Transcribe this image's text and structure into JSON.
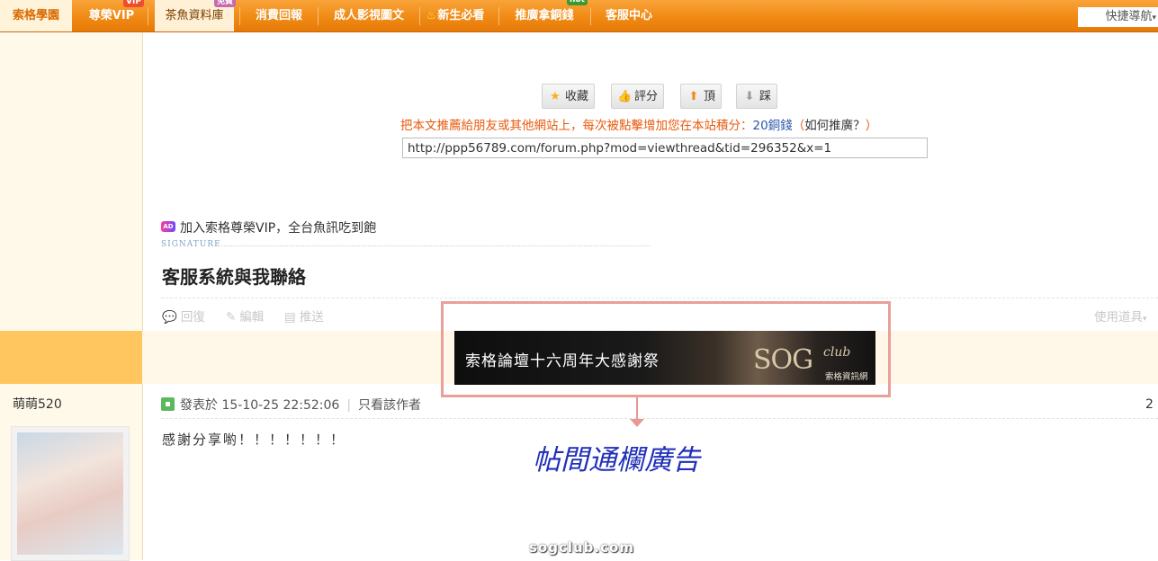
{
  "nav": {
    "items": [
      "索格學園",
      "尊榮VIP",
      "茶魚資料庫",
      "消費回報",
      "成人影視圖文",
      "新生必看",
      "推廣拿銅錢",
      "客服中心"
    ],
    "badges": {
      "vip": "VIP",
      "free": "免費",
      "hot": "hot"
    },
    "quick_nav": "快捷導航"
  },
  "actions": {
    "favorite": "收藏",
    "rate": "評分",
    "up": "頂",
    "down": "踩"
  },
  "recommend": {
    "text": "把本文推薦給朋友或其他網站上，每次被點擊增加您在本站積分：",
    "points": "20銅錢",
    "open_paren": "（",
    "how": "如何推廣？",
    "close_paren": "）",
    "url": "http://ppp56789.com/forum.php?mod=viewthread&tid=296352&x=1"
  },
  "post": {
    "ad_icon": "AD",
    "ad_text": "加入索格尊榮VIP，全台魚訊吃到飽",
    "signature_label": "SIGNATURE",
    "signature_title": "客服系統與我聯絡",
    "tools": {
      "reply": "回復",
      "edit": "編輯",
      "push": "推送",
      "right": "使用道具"
    }
  },
  "banner": {
    "text": "索格論壇十六周年大感謝祭",
    "logo": "SOG",
    "club": "club",
    "sub": "索格資訊網",
    "callout": "帖間通欄廣告"
  },
  "reply": {
    "username": "萌萌520",
    "posted": "發表於 15-10-25 22:52:06",
    "only_author": "只看該作者",
    "floor": "2",
    "content": "感謝分享喲！！！！！！！"
  },
  "watermark": "sogclub.com",
  "colors": {
    "nav": "#f08a14",
    "callout": "#1f2fb8",
    "highlight": "#e9a09a"
  }
}
